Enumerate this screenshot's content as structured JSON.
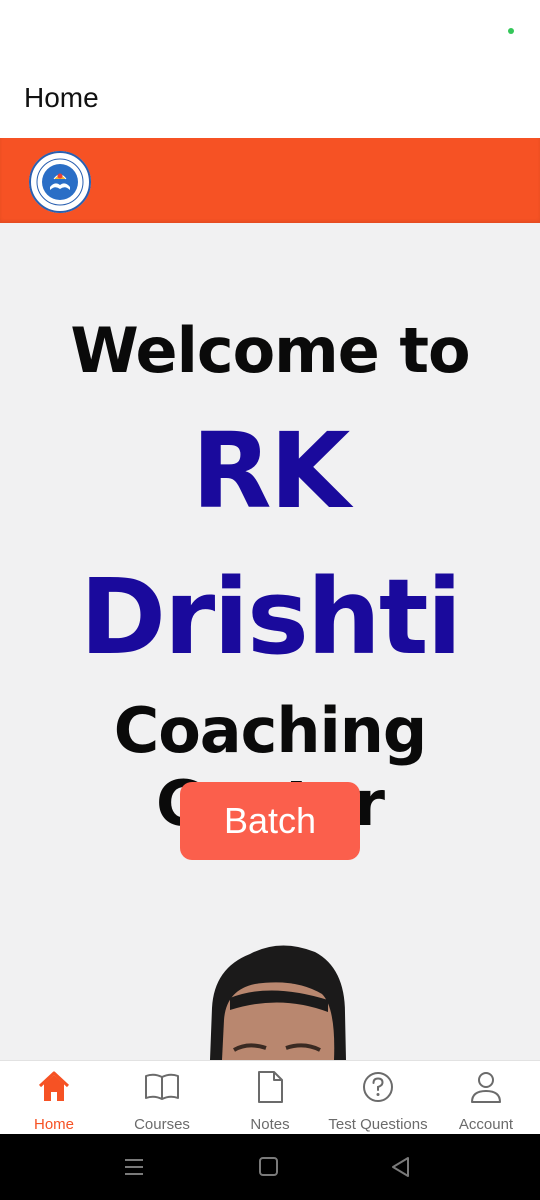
{
  "header": {
    "title": "Home"
  },
  "brand": {
    "logo_icon": "rk-drishti-logo-icon",
    "logo_text": "RK DRISHTI COACHING CENTER",
    "bar_color": "#f65224"
  },
  "welcome": {
    "line1": "Welcome to",
    "line2": "RK",
    "line3": "Drishti",
    "line4": "Coaching Center"
  },
  "batch_button": {
    "label": "Batch",
    "color": "#fb5f4c"
  },
  "colors": {
    "title_blue": "#1a0a9c",
    "active_nav": "#f65224"
  },
  "bottom_nav": {
    "items": [
      {
        "label": "Home",
        "icon": "home-icon",
        "active": true
      },
      {
        "label": "Courses",
        "icon": "book-icon",
        "active": false
      },
      {
        "label": "Notes",
        "icon": "document-icon",
        "active": false
      },
      {
        "label": "Test Questions",
        "icon": "help-circle-icon",
        "active": false
      },
      {
        "label": "Account",
        "icon": "person-icon",
        "active": false
      }
    ]
  },
  "system_nav": {
    "icons": [
      "menu-icon",
      "square-icon",
      "back-triangle-icon"
    ]
  }
}
